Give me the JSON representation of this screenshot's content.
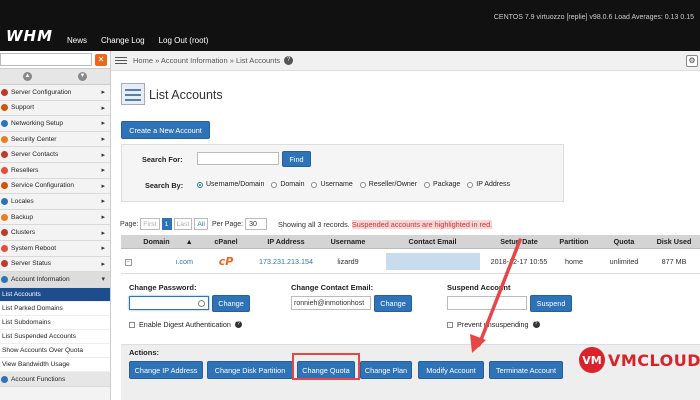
{
  "topbar": {
    "system_info": "CENTOS 7.9 virtuozzo [replie]   v98.0.6   Load Averages: 0.13 0.15",
    "logo": "WHM",
    "nav": [
      "News",
      "Change Log",
      "Log Out (root)"
    ]
  },
  "sidebar": {
    "items": [
      {
        "label": "Server Configuration",
        "color": "#c0392b"
      },
      {
        "label": "Support",
        "color": "#d35400"
      },
      {
        "label": "Networking Setup",
        "color": "#2e73b8"
      },
      {
        "label": "Security Center",
        "color": "#e67e22"
      },
      {
        "label": "Server Contacts",
        "color": "#c0392b"
      },
      {
        "label": "Resellers",
        "color": "#e74c3c"
      },
      {
        "label": "Service Configuration",
        "color": "#d35400"
      },
      {
        "label": "Locales",
        "color": "#2e73b8"
      },
      {
        "label": "Backup",
        "color": "#e67e22"
      },
      {
        "label": "Clusters",
        "color": "#c0392b"
      },
      {
        "label": "System Reboot",
        "color": "#e74c3c"
      },
      {
        "label": "Server Status",
        "color": "#c0392b"
      },
      {
        "label": "Account Information",
        "color": "#2e73b8"
      }
    ],
    "sub_items": [
      "List Accounts",
      "List Parked Domains",
      "List Subdomains",
      "List Suspended Accounts",
      "Show Accounts Over Quota",
      "View Bandwidth Usage"
    ],
    "last_item": "Account Functions"
  },
  "breadcrumb": "Home » Account Information » List Accounts",
  "page": {
    "title": "List Accounts",
    "create_button": "Create a New Account"
  },
  "search": {
    "search_for_label": "Search For:",
    "find_button": "Find",
    "search_by_label": "Search By:",
    "options": [
      "Username/Domain",
      "Domain",
      "Username",
      "Reseller/Owner",
      "Package",
      "IP Address"
    ],
    "selected": "Username/Domain"
  },
  "pager": {
    "page_label": "Page:",
    "first": "First",
    "current": "1",
    "last": "Last",
    "all": "All",
    "per_page_label": "Per Page:",
    "per_page_value": "30",
    "records_text": "Showing all 3 records.",
    "suspended_note": "Suspended accounts are highlighted in red."
  },
  "table": {
    "columns": [
      "Domain",
      "cPanel",
      "IP Address",
      "Username",
      "Contact Email",
      "Setup Date",
      "Partition",
      "Quota",
      "Disk Used"
    ],
    "sort_indicator": "▲",
    "row": {
      "domain": "ı.com",
      "cpanel": "cP",
      "ip": "173.231.213.154",
      "username": "lizard9",
      "setup_date": "2018-12-17 10:55",
      "partition": "home",
      "quota": "unlimited",
      "disk_used": "877 MB"
    }
  },
  "details": {
    "change_password_title": "Change Password:",
    "change_password_button": "Change",
    "digest_label": "Enable Digest Authentication",
    "change_email_title": "Change Contact Email:",
    "email_value": "ronnieh@inmotionhost",
    "change_email_button": "Change",
    "suspend_title": "Suspend Account",
    "suspend_button": "Suspend",
    "prevent_label": "Prevent unsuspending"
  },
  "actions": {
    "title": "Actions:",
    "buttons": [
      "Change IP Address",
      "Change Disk Partition",
      "Change Quota",
      "Change Plan",
      "Modify Account",
      "Terminate Account"
    ]
  },
  "brand": {
    "mark": "VM",
    "word": "VMCLOUDZ"
  }
}
